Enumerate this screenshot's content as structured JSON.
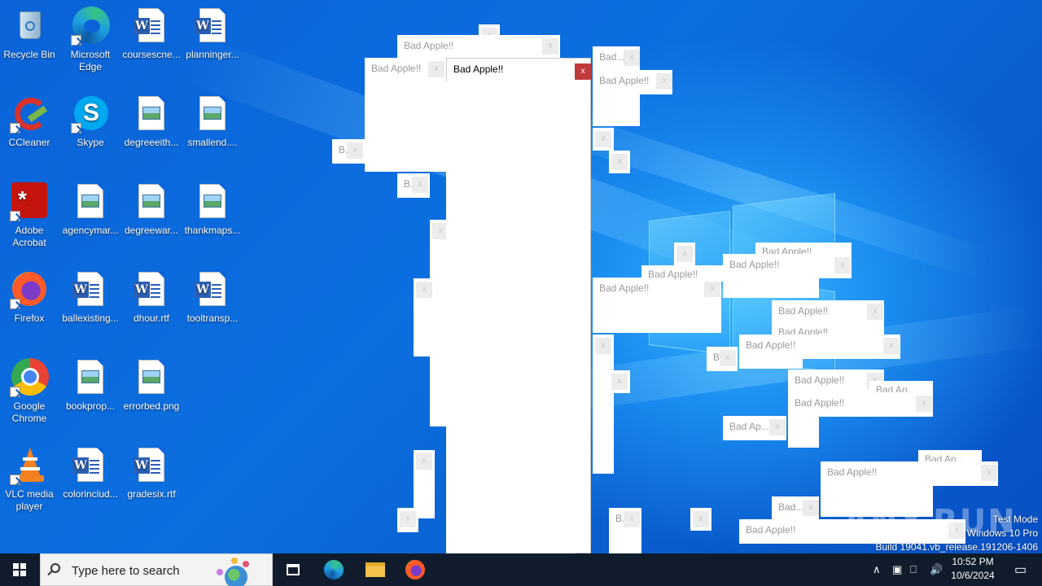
{
  "desktop": {
    "icons": [
      {
        "label": "Recycle Bin",
        "icon": "recycle-bin-icon"
      },
      {
        "label": "Microsoft Edge",
        "icon": "edge-icon"
      },
      {
        "label": "coursescne...",
        "icon": "word-doc-icon"
      },
      {
        "label": "planninger...",
        "icon": "word-doc-icon"
      },
      {
        "label": "CCleaner",
        "icon": "ccleaner-icon"
      },
      {
        "label": "Skype",
        "icon": "skype-icon"
      },
      {
        "label": "degreeeith...",
        "icon": "image-file-icon"
      },
      {
        "label": "smallend....",
        "icon": "image-file-icon"
      },
      {
        "label": "Adobe Acrobat",
        "icon": "acrobat-icon"
      },
      {
        "label": "agencymar...",
        "icon": "image-file-icon"
      },
      {
        "label": "degreewar...",
        "icon": "image-file-icon"
      },
      {
        "label": "thankmaps...",
        "icon": "image-file-icon"
      },
      {
        "label": "Firefox",
        "icon": "firefox-icon"
      },
      {
        "label": "ballexisting...",
        "icon": "word-doc-icon"
      },
      {
        "label": "dhour.rtf",
        "icon": "word-doc-icon"
      },
      {
        "label": "tooltransp...",
        "icon": "word-doc-icon"
      },
      {
        "label": "Google Chrome",
        "icon": "chrome-icon"
      },
      {
        "label": "bookprop...",
        "icon": "image-file-icon"
      },
      {
        "label": "errorbed.png",
        "icon": "image-file-icon"
      },
      {
        "label": "VLC media player",
        "icon": "vlc-icon"
      },
      {
        "label": "colorinclud...",
        "icon": "word-doc-icon"
      },
      {
        "label": "gradesix.rtf",
        "icon": "word-doc-icon"
      }
    ]
  },
  "popups": {
    "title_full": "Bad Apple!!",
    "title_b": "B.",
    "title_bad": "Bad...",
    "title_badap": "Bad Ap...",
    "title_badan": "Bad An...",
    "close_glyph": "x"
  },
  "watermark": {
    "text": "ANY.RUN"
  },
  "windows_info": {
    "line1": "Test Mode",
    "line2": "Windows 10 Pro",
    "line3": "Build 19041.vb_release.191206-1406"
  },
  "taskbar": {
    "search_placeholder": "Type here to search",
    "time": "10:52 PM",
    "date": "10/6/2024",
    "colors": {
      "taskbar": "#101c2b",
      "accent": "#0a63d8",
      "close_active": "#c0393b"
    }
  }
}
